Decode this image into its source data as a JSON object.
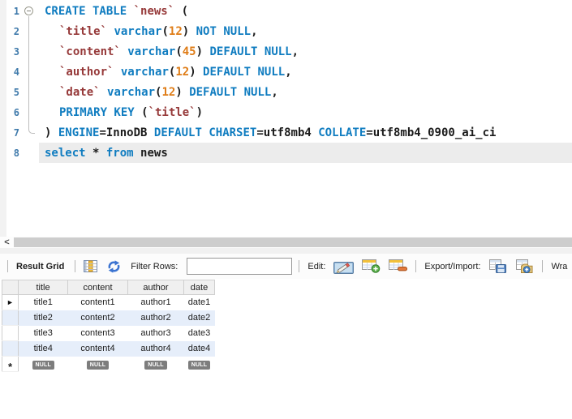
{
  "colors": {
    "keyword": "#0f7cc0",
    "identifier": "#963939",
    "number": "#df7c16",
    "plain_text": "#1b1b1b",
    "line_number": "#3f7aab",
    "statement_highlight": "#ececec",
    "row_alternate": "#e6eefa",
    "null_badge_bg": "#7d7d7d"
  },
  "editor": {
    "lines": [
      {
        "no": 1,
        "fold": "start",
        "indent": 0,
        "highlight": false,
        "tokens": [
          [
            "kw",
            "CREATE TABLE"
          ],
          [
            "pl",
            " "
          ],
          [
            "id",
            "`news`"
          ],
          [
            "pl",
            " ("
          ]
        ]
      },
      {
        "no": 2,
        "fold": "mid",
        "indent": 1,
        "highlight": false,
        "tokens": [
          [
            "id",
            "`title`"
          ],
          [
            "pl",
            " "
          ],
          [
            "kw",
            "varchar"
          ],
          [
            "pl",
            "("
          ],
          [
            "num",
            "12"
          ],
          [
            "pl",
            ") "
          ],
          [
            "kw",
            "NOT NULL"
          ],
          [
            "pl",
            ","
          ]
        ]
      },
      {
        "no": 3,
        "fold": "mid",
        "indent": 1,
        "highlight": false,
        "tokens": [
          [
            "id",
            "`content`"
          ],
          [
            "pl",
            " "
          ],
          [
            "kw",
            "varchar"
          ],
          [
            "pl",
            "("
          ],
          [
            "num",
            "45"
          ],
          [
            "pl",
            ") "
          ],
          [
            "kw",
            "DEFAULT NULL"
          ],
          [
            "pl",
            ","
          ]
        ]
      },
      {
        "no": 4,
        "fold": "mid",
        "indent": 1,
        "highlight": false,
        "tokens": [
          [
            "id",
            "`author`"
          ],
          [
            "pl",
            " "
          ],
          [
            "kw",
            "varchar"
          ],
          [
            "pl",
            "("
          ],
          [
            "num",
            "12"
          ],
          [
            "pl",
            ") "
          ],
          [
            "kw",
            "DEFAULT NULL"
          ],
          [
            "pl",
            ","
          ]
        ]
      },
      {
        "no": 5,
        "fold": "mid",
        "indent": 1,
        "highlight": false,
        "tokens": [
          [
            "id",
            "`date`"
          ],
          [
            "pl",
            " "
          ],
          [
            "kw",
            "varchar"
          ],
          [
            "pl",
            "("
          ],
          [
            "num",
            "12"
          ],
          [
            "pl",
            ") "
          ],
          [
            "kw",
            "DEFAULT NULL"
          ],
          [
            "pl",
            ","
          ]
        ]
      },
      {
        "no": 6,
        "fold": "mid",
        "indent": 1,
        "highlight": false,
        "tokens": [
          [
            "kw",
            "PRIMARY KEY"
          ],
          [
            "pl",
            " ("
          ],
          [
            "id",
            "`title`"
          ],
          [
            "pl",
            ")"
          ]
        ]
      },
      {
        "no": 7,
        "fold": "end",
        "indent": 0,
        "highlight": false,
        "tokens": [
          [
            "pl",
            ") "
          ],
          [
            "kw",
            "ENGINE"
          ],
          [
            "pl",
            "="
          ],
          [
            "val",
            "InnoDB"
          ],
          [
            "pl",
            " "
          ],
          [
            "kw",
            "DEFAULT"
          ],
          [
            "pl",
            " "
          ],
          [
            "kw",
            "CHARSET"
          ],
          [
            "pl",
            "="
          ],
          [
            "val",
            "utf8mb4"
          ],
          [
            "pl",
            " "
          ],
          [
            "kw",
            "COLLATE"
          ],
          [
            "pl",
            "="
          ],
          [
            "val",
            "utf8mb4_0900_ai_ci"
          ]
        ]
      },
      {
        "no": 8,
        "fold": "none",
        "indent": 0,
        "highlight": true,
        "tokens": [
          [
            "kw",
            "select"
          ],
          [
            "pl",
            " * "
          ],
          [
            "kw",
            "from"
          ],
          [
            "pl",
            " "
          ],
          [
            "val",
            "news"
          ]
        ]
      }
    ]
  },
  "scrollbar": {
    "left_arrow": "<"
  },
  "result_toolbar": {
    "result_grid_label": "Result Grid",
    "filter_rows_label": "Filter Rows:",
    "filter_input_value": "",
    "edit_label": "Edit:",
    "export_import_label": "Export/Import:",
    "wrap_label_clipped": "Wra",
    "icons": [
      "result-grid-icon",
      "refresh-icon",
      "edit-record-icon",
      "add-row-icon",
      "delete-row-icon",
      "export-icon",
      "import-icon"
    ]
  },
  "grid": {
    "columns": [
      "title",
      "content",
      "author",
      "date"
    ],
    "rows": [
      [
        "title1",
        "content1",
        "author1",
        "date1"
      ],
      [
        "title2",
        "content2",
        "author2",
        "date2"
      ],
      [
        "title3",
        "content3",
        "author3",
        "date3"
      ],
      [
        "title4",
        "content4",
        "author4",
        "date4"
      ]
    ],
    "null_row": [
      "NULL",
      "NULL",
      "NULL",
      "NULL"
    ],
    "current_row_marker": "►",
    "new_row_marker": "*"
  }
}
